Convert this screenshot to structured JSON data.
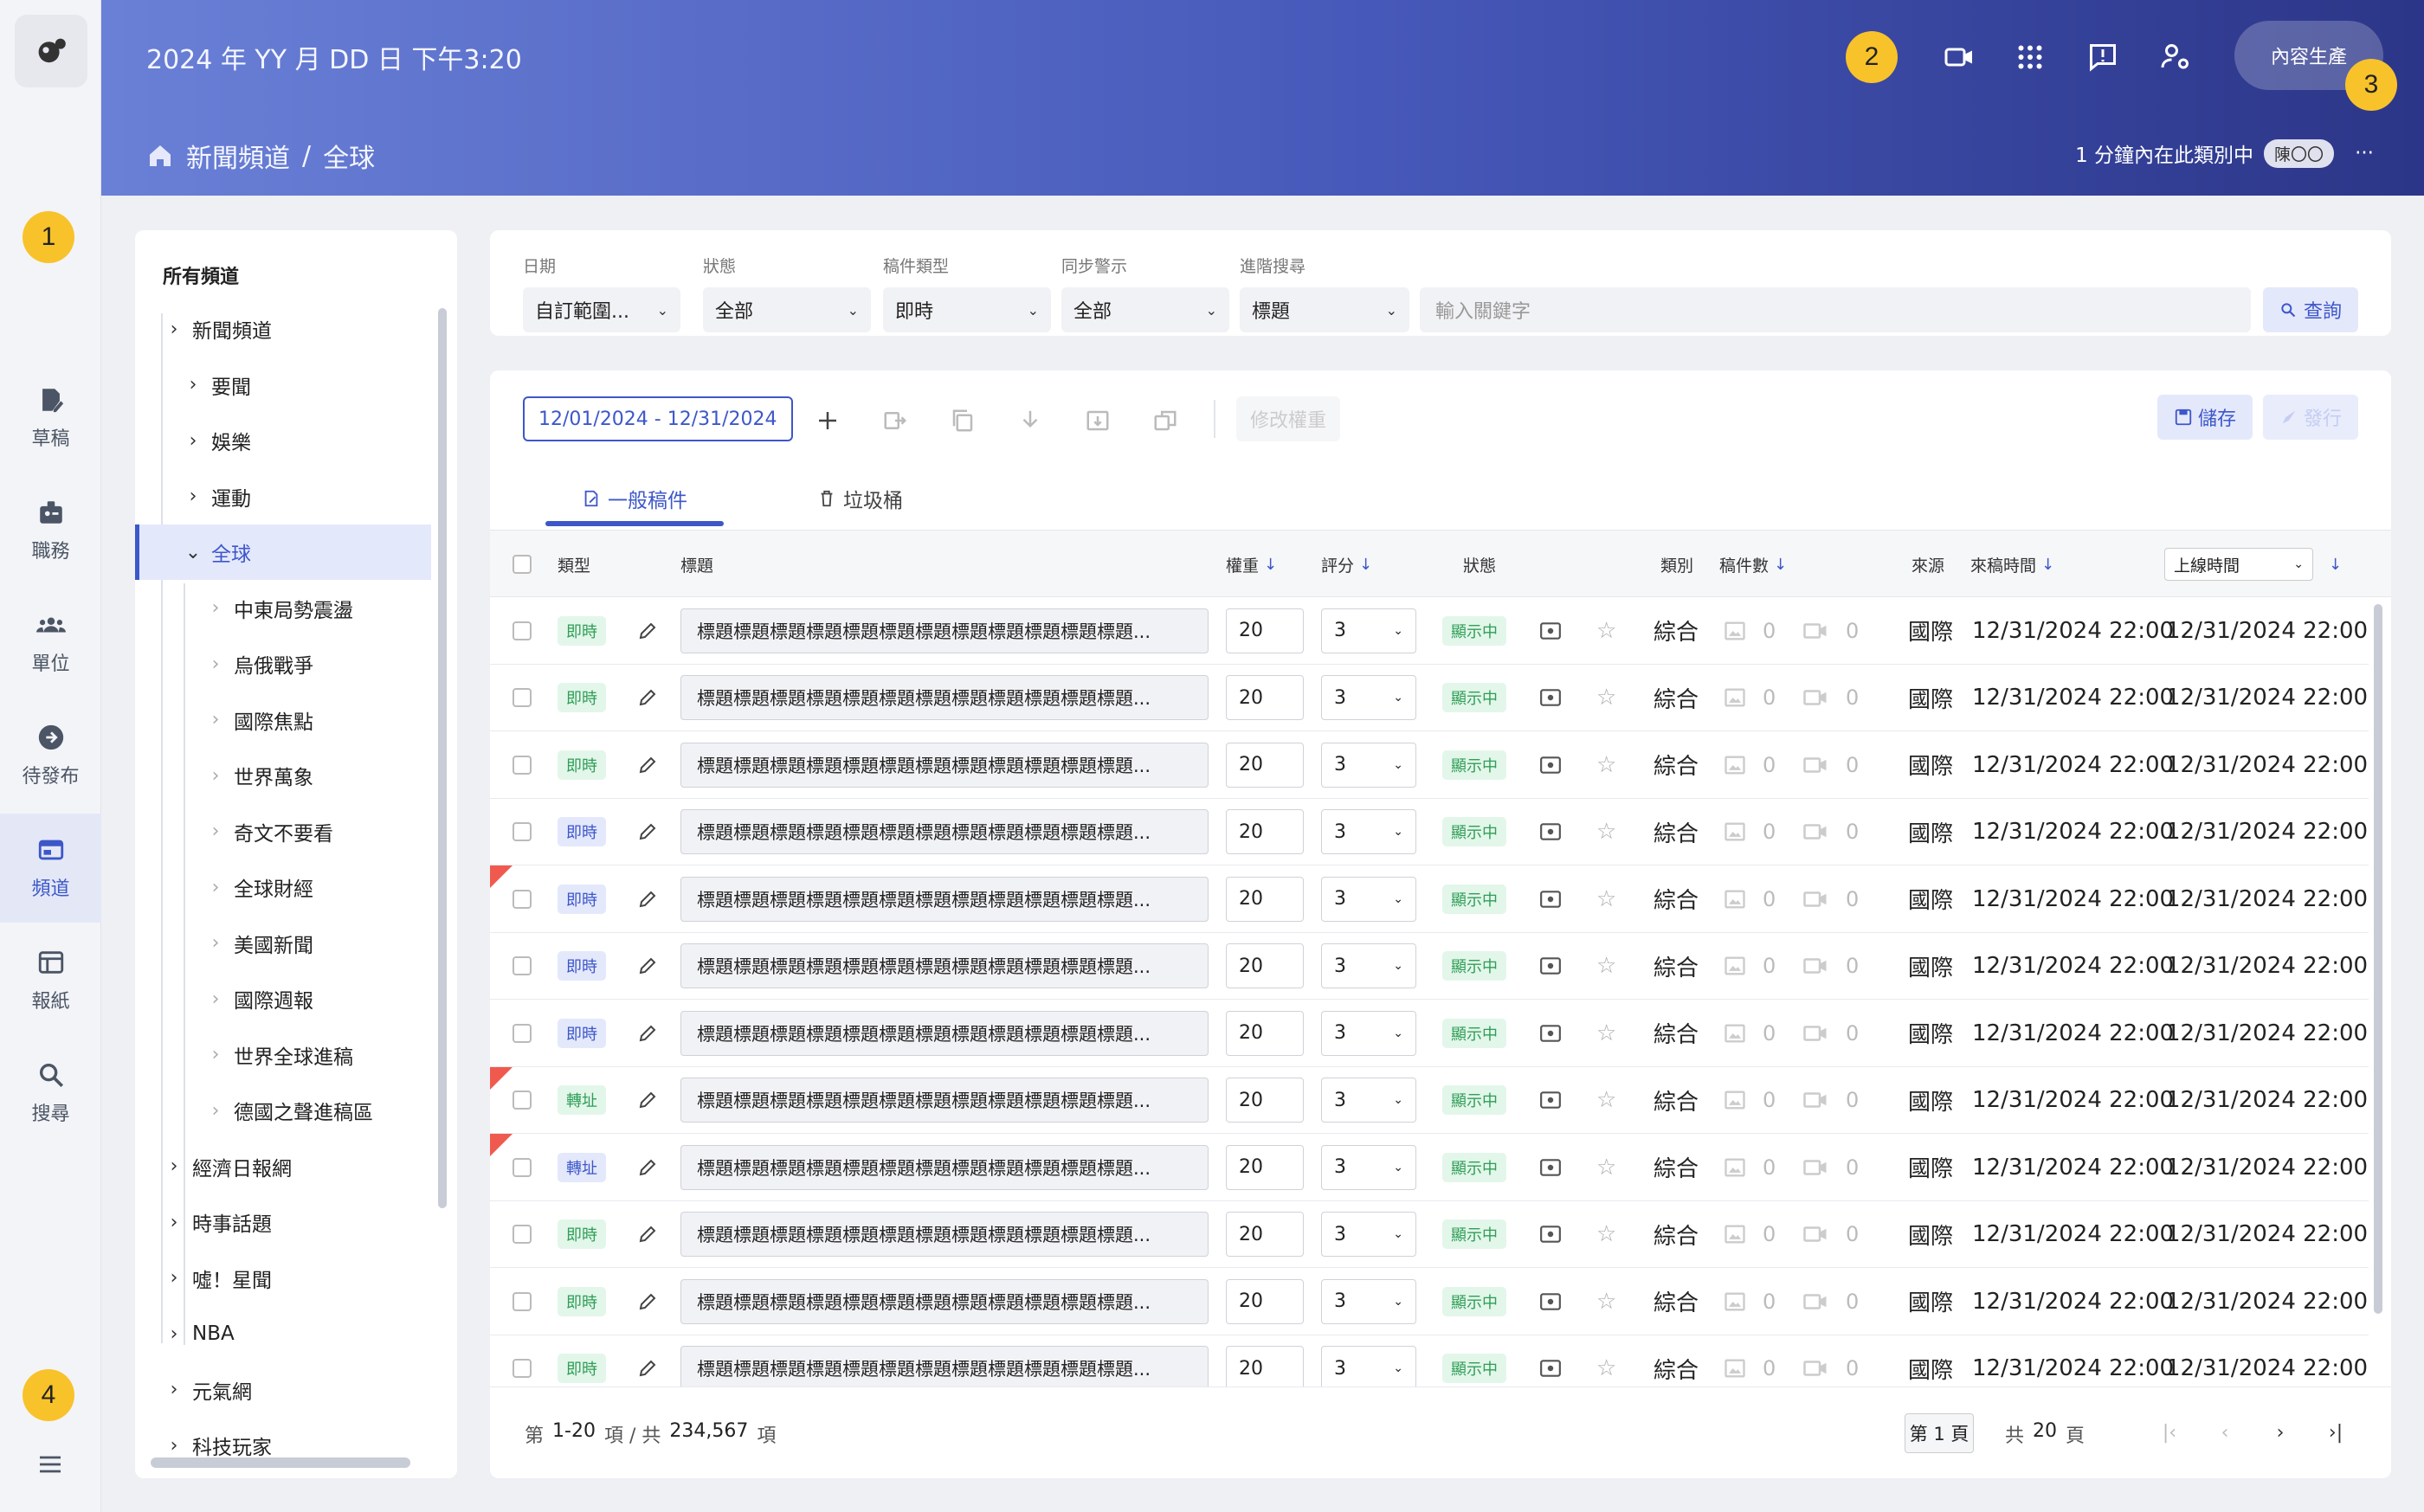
{
  "leftnav": {
    "badge_1": "1",
    "badge_4": "4",
    "items": [
      {
        "label": "草稿",
        "icon": "draft-icon"
      },
      {
        "label": "職務",
        "icon": "badge-icon"
      },
      {
        "label": "單位",
        "icon": "group-icon"
      },
      {
        "label": "待發布",
        "icon": "arrow-circle-icon"
      },
      {
        "label": "頻道",
        "icon": "channel-icon",
        "active": true
      },
      {
        "label": "報紙",
        "icon": "newspaper-icon"
      },
      {
        "label": "搜尋",
        "icon": "search-icon"
      }
    ]
  },
  "header": {
    "datetime": "2024 年 YY 月 DD 日  下午3:20",
    "badge_2": "2",
    "badge_3": "3",
    "production_button": "內容生產",
    "breadcrumb": {
      "parent": "新聞頻道",
      "separator": "/",
      "current": "全球"
    },
    "status_text": "1 分鐘內在此類別中",
    "user": "陳〇〇",
    "more": "···"
  },
  "tree": {
    "title": "所有頻道",
    "items": [
      {
        "label": "新聞頻道",
        "level": 0
      },
      {
        "label": "要聞",
        "level": 1
      },
      {
        "label": "娛樂",
        "level": 1
      },
      {
        "label": "運動",
        "level": 1
      },
      {
        "label": "全球",
        "level": 1,
        "selected": true
      },
      {
        "label": "中東局勢震盪",
        "level": 2
      },
      {
        "label": "烏俄戰爭",
        "level": 2
      },
      {
        "label": "國際焦點",
        "level": 2
      },
      {
        "label": "世界萬象",
        "level": 2
      },
      {
        "label": "奇文不要看",
        "level": 2
      },
      {
        "label": "全球財經",
        "level": 2
      },
      {
        "label": "美國新聞",
        "level": 2
      },
      {
        "label": "國際週報",
        "level": 2
      },
      {
        "label": "世界全球進稿",
        "level": 2
      },
      {
        "label": "德國之聲進稿區",
        "level": 2
      },
      {
        "label": "經濟日報網",
        "level": 0
      },
      {
        "label": "時事話題",
        "level": 0
      },
      {
        "label": "噓！星聞",
        "level": 0
      },
      {
        "label": "NBA",
        "level": 0
      },
      {
        "label": "元氣網",
        "level": 0
      },
      {
        "label": "科技玩家",
        "level": 0
      }
    ]
  },
  "filter": {
    "date": {
      "label": "日期",
      "value": "自訂範圍..."
    },
    "status": {
      "label": "狀態",
      "value": "全部"
    },
    "doctype": {
      "label": "稿件類型",
      "value": "即時"
    },
    "sync": {
      "label": "同步警示",
      "value": "全部"
    },
    "advanced": {
      "label": "進階搜尋",
      "value": "標題"
    },
    "keyword_placeholder": "輸入關鍵字",
    "search_button": "查詢"
  },
  "toolbar": {
    "date_range": "12/01/2024 - 12/31/2024",
    "modify_weight": "修改權重",
    "save": "儲存",
    "publish": "發行"
  },
  "tabs": [
    {
      "label": "一般稿件",
      "active": true
    },
    {
      "label": "垃圾桶"
    }
  ],
  "table": {
    "headers": {
      "type": "類型",
      "title": "標題",
      "weight": "權重",
      "score": "評分",
      "status": "狀態",
      "category": "類別",
      "count": "稿件數",
      "source": "來源",
      "received": "來稿時間",
      "online_select": "上線時間"
    },
    "rows": [
      {
        "type": "即時",
        "type_style": "a",
        "title": "標題標題標題標題標題標題標題標題標題標題標題標題...",
        "weight": "20",
        "score": "3",
        "status": "顯示中",
        "category": "綜合",
        "images": "0",
        "videos": "0",
        "source": "國際",
        "received": "12/31/2024 22:00",
        "online": "12/31/2024 22:00",
        "flag": false
      },
      {
        "type": "即時",
        "type_style": "a",
        "title": "標題標題標題標題標題標題標題標題標題標題標題標題...",
        "weight": "20",
        "score": "3",
        "status": "顯示中",
        "category": "綜合",
        "images": "0",
        "videos": "0",
        "source": "國際",
        "received": "12/31/2024 22:00",
        "online": "12/31/2024 22:00",
        "flag": false
      },
      {
        "type": "即時",
        "type_style": "a",
        "title": "標題標題標題標題標題標題標題標題標題標題標題標題...",
        "weight": "20",
        "score": "3",
        "status": "顯示中",
        "category": "綜合",
        "images": "0",
        "videos": "0",
        "source": "國際",
        "received": "12/31/2024 22:00",
        "online": "12/31/2024 22:00",
        "flag": false
      },
      {
        "type": "即時",
        "type_style": "b",
        "title": "標題標題標題標題標題標題標題標題標題標題標題標題...",
        "weight": "20",
        "score": "3",
        "status": "顯示中",
        "category": "綜合",
        "images": "0",
        "videos": "0",
        "source": "國際",
        "received": "12/31/2024 22:00",
        "online": "12/31/2024 22:00",
        "flag": false
      },
      {
        "type": "即時",
        "type_style": "b",
        "title": "標題標題標題標題標題標題標題標題標題標題標題標題...",
        "weight": "20",
        "score": "3",
        "status": "顯示中",
        "category": "綜合",
        "images": "0",
        "videos": "0",
        "source": "國際",
        "received": "12/31/2024 22:00",
        "online": "12/31/2024 22:00",
        "flag": true
      },
      {
        "type": "即時",
        "type_style": "b",
        "title": "標題標題標題標題標題標題標題標題標題標題標題標題...",
        "weight": "20",
        "score": "3",
        "status": "顯示中",
        "category": "綜合",
        "images": "0",
        "videos": "0",
        "source": "國際",
        "received": "12/31/2024 22:00",
        "online": "12/31/2024 22:00",
        "flag": false
      },
      {
        "type": "即時",
        "type_style": "b",
        "title": "標題標題標題標題標題標題標題標題標題標題標題標題...",
        "weight": "20",
        "score": "3",
        "status": "顯示中",
        "category": "綜合",
        "images": "0",
        "videos": "0",
        "source": "國際",
        "received": "12/31/2024 22:00",
        "online": "12/31/2024 22:00",
        "flag": false
      },
      {
        "type": "轉址",
        "type_style": "a",
        "title": "標題標題標題標題標題標題標題標題標題標題標題標題...",
        "weight": "20",
        "score": "3",
        "status": "顯示中",
        "category": "綜合",
        "images": "0",
        "videos": "0",
        "source": "國際",
        "received": "12/31/2024 22:00",
        "online": "12/31/2024 22:00",
        "flag": true
      },
      {
        "type": "轉址",
        "type_style": "b",
        "title": "標題標題標題標題標題標題標題標題標題標題標題標題...",
        "weight": "20",
        "score": "3",
        "status": "顯示中",
        "category": "綜合",
        "images": "0",
        "videos": "0",
        "source": "國際",
        "received": "12/31/2024 22:00",
        "online": "12/31/2024 22:00",
        "flag": true
      },
      {
        "type": "即時",
        "type_style": "a",
        "title": "標題標題標題標題標題標題標題標題標題標題標題標題...",
        "weight": "20",
        "score": "3",
        "status": "顯示中",
        "category": "綜合",
        "images": "0",
        "videos": "0",
        "source": "國際",
        "received": "12/31/2024 22:00",
        "online": "12/31/2024 22:00",
        "flag": false
      },
      {
        "type": "即時",
        "type_style": "a",
        "title": "標題標題標題標題標題標題標題標題標題標題標題標題...",
        "weight": "20",
        "score": "3",
        "status": "顯示中",
        "category": "綜合",
        "images": "0",
        "videos": "0",
        "source": "國際",
        "received": "12/31/2024 22:00",
        "online": "12/31/2024 22:00",
        "flag": false
      },
      {
        "type": "即時",
        "type_style": "a",
        "title": "標題標題標題標題標題標題標題標題標題標題標題標題...",
        "weight": "20",
        "score": "3",
        "status": "顯示中",
        "category": "綜合",
        "images": "0",
        "videos": "0",
        "source": "國際",
        "received": "12/31/2024 22:00",
        "online": "12/31/2024 22:00",
        "flag": false
      }
    ]
  },
  "pagination": {
    "prefix": "第",
    "range": "1-20",
    "middle": "項 / 共",
    "total": "234,567",
    "suffix": "項",
    "current_page": "第 1 頁",
    "pages_prefix": "共",
    "pages": "20",
    "pages_suffix": "頁"
  },
  "colors": {
    "accent": "#3d57c9",
    "badge": "#f8c22b",
    "status_green": "#2f9e57",
    "flag_red": "#f05a4e"
  }
}
